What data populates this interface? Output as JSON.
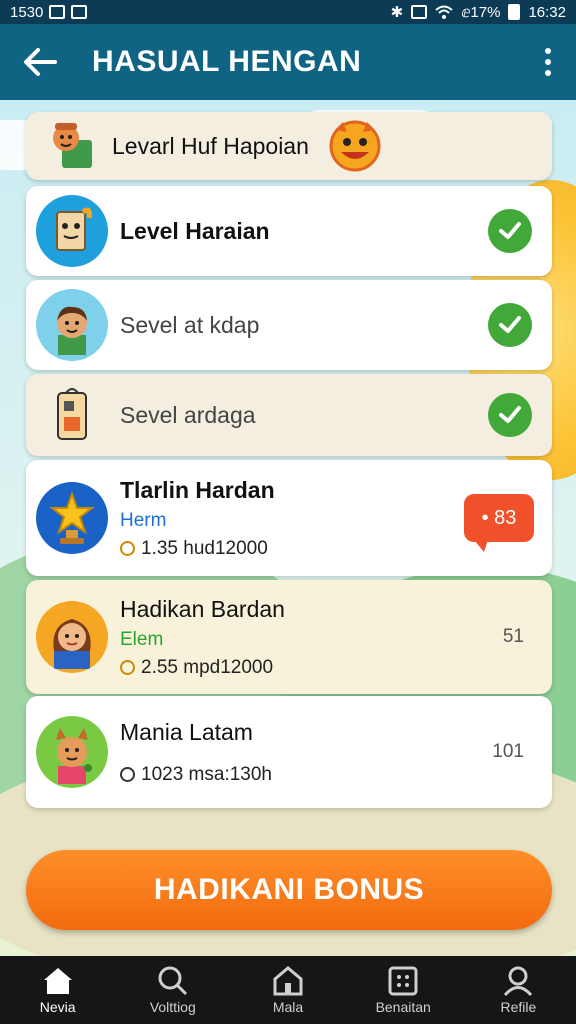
{
  "status_bar": {
    "time_left": "1530",
    "battery": "ⅇ17%",
    "time_right": "16:32"
  },
  "app_bar": {
    "title": "HASUAL HENGAN"
  },
  "rows": [
    {
      "label": "Levarl Huf Hapoian"
    },
    {
      "label": "Level Haraian",
      "completed": true
    },
    {
      "label": "Sevel at kdap",
      "completed": true
    },
    {
      "label": "Sevel ardaga",
      "completed": true
    },
    {
      "label": "Tlarlin Hardan",
      "sub": "Herm",
      "meta": "1.35 hud12000",
      "badge": "• 83"
    },
    {
      "label": "Hadikan Bardan",
      "sub": "Elem",
      "meta": "2.55 mpd12000",
      "count": "51"
    },
    {
      "label": "Mania Latam",
      "meta": "1023 msa:130h",
      "count": "101"
    }
  ],
  "bonus_button": "HADIKANI BONUS",
  "bottom_nav": [
    {
      "label": "Nevia",
      "icon": "home-icon",
      "active": true
    },
    {
      "label": "Volttiog",
      "icon": "search-icon"
    },
    {
      "label": "Mala",
      "icon": "house-icon"
    },
    {
      "label": "Benaitan",
      "icon": "grid-icon"
    },
    {
      "label": "Refile",
      "icon": "profile-icon"
    }
  ],
  "colors": {
    "app_bar": "#0f6383",
    "status_bar": "#0d3a55",
    "check": "#43a83a",
    "badge": "#f0502a",
    "bonus": "#f57a17",
    "link_blue": "#1e6fd9",
    "link_green": "#2aa52a"
  }
}
